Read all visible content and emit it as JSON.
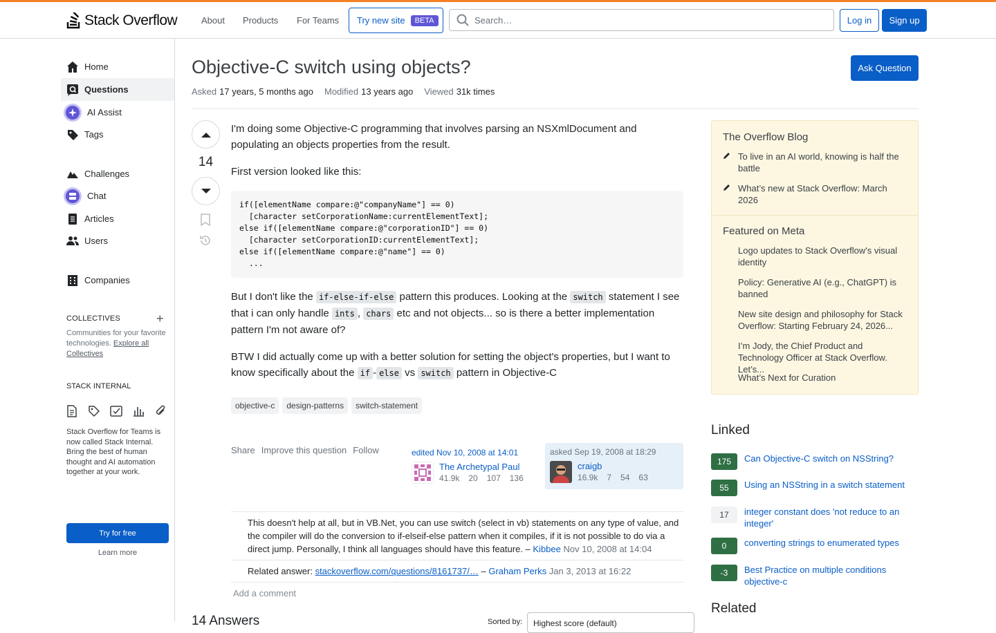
{
  "header": {
    "logo_text": "Stack Overflow",
    "nav": [
      "About",
      "Products",
      "For Teams"
    ],
    "try_new_site": "Try new site",
    "beta_badge": "BETA",
    "search_placeholder": "Search…",
    "login": "Log in",
    "signup": "Sign up"
  },
  "sidebar": {
    "items": [
      {
        "label": "Home",
        "icon": "home-icon"
      },
      {
        "label": "Questions",
        "icon": "questions-icon"
      },
      {
        "label": "AI Assist",
        "icon": "ai-assist-icon"
      },
      {
        "label": "Tags",
        "icon": "tag-icon"
      },
      {
        "label": "Challenges",
        "icon": "challenges-icon"
      },
      {
        "label": "Chat",
        "icon": "chat-icon"
      },
      {
        "label": "Articles",
        "icon": "articles-icon"
      },
      {
        "label": "Users",
        "icon": "users-icon"
      },
      {
        "label": "Companies",
        "icon": "companies-icon"
      }
    ],
    "collectives_heading": "COLLECTIVES",
    "collectives_desc": "Communities for your favorite technologies.",
    "collectives_link": "Explore all Collectives",
    "stack_internal_heading": "STACK INTERNAL",
    "stack_internal_desc": "Stack Overflow for Teams is now called Stack Internal. Bring the best of human thought and AI automation together at your work.",
    "try_free": "Try for free",
    "learn_more": "Learn more"
  },
  "question": {
    "title": "Objective-C switch using objects?",
    "ask_button": "Ask Question",
    "asked_label": "Asked",
    "asked_value": "17 years, 5 months ago",
    "modified_label": "Modified",
    "modified_value": "13 years ago",
    "viewed_label": "Viewed",
    "viewed_value": "31k times",
    "votes": "14",
    "body_p1": "I'm doing some Objective-C programming that involves parsing an NSXmlDocument and populating an objects properties from the result.",
    "body_p2": "First version looked like this:",
    "code": "if([elementName compare:@\"companyName\"] == 0)\n  [character setCorporationName:currentElementText];\nelse if([elementName compare:@\"corporationID\"] == 0)\n  [character setCorporationID:currentElementText];\nelse if([elementName compare:@\"name\"] == 0)\n  ...",
    "p3_a": "But I don't like the ",
    "p3_code1": "if-else-if-else",
    "p3_b": " pattern this produces. Looking at the ",
    "p3_code2": "switch",
    "p3_c": " statement I see that i can only handle ",
    "p3_code3": "ints",
    "p3_d": ", ",
    "p3_code4": "chars",
    "p3_e": " etc and not objects... so is there a better implementation pattern I'm not aware of?",
    "p4_a": "BTW I did actually come up with a better solution for setting the object's properties, but I want to know specifically about the ",
    "p4_code1": "if",
    "p4_dash": "-",
    "p4_code2": "else",
    "p4_b": " vs ",
    "p4_code3": "switch",
    "p4_c": " pattern in Objective-C",
    "tags": [
      "objective-c",
      "design-patterns",
      "switch-statement"
    ],
    "actions": [
      "Share",
      "Improve this question",
      "Follow"
    ],
    "edited": {
      "label": "edited Nov 10, 2008 at 14:01",
      "user": "The Archetypal Paul",
      "rep": "41.9k",
      "gold": "20",
      "silver": "107",
      "bronze": "136"
    },
    "asked": {
      "label": "asked Sep 19, 2008 at 18:29",
      "user": "craigb",
      "rep": "16.9k",
      "gold": "7",
      "silver": "54",
      "bronze": "63"
    },
    "comments": [
      {
        "text": "This doesn't help at all, but in VB.Net, you can use switch (select in vb) statements on any type of value, and the compiler will do the conversion to if-elseif-else pattern when it compiles, if it is not possible to do via a direct jump. Personally, I think all languages should have this feature. – ",
        "user": "Kibbee",
        "date": "Nov 10, 2008 at 14:04"
      },
      {
        "text": "Related answer: ",
        "link": "stackoverflow.com/questions/8161737/…",
        "sep": " – ",
        "user": "Graham Perks",
        "date": "Jan 3, 2013 at 16:22"
      }
    ],
    "add_comment": "Add a comment"
  },
  "answers": {
    "heading": "14 Answers",
    "sort_label": "Sorted by:",
    "sort_value": "Highest score (default)"
  },
  "right": {
    "blog_heading": "The Overflow Blog",
    "blog_items": [
      "To live in an AI world, knowing is half the battle",
      "What’s new at Stack Overflow: March 2026"
    ],
    "meta_heading": "Featured on Meta",
    "meta_items": [
      "Logo updates to Stack Overflow's visual identity",
      "Policy: Generative AI (e.g., ChatGPT) is banned",
      "New site design and philosophy for Stack Overflow: Starting February 24, 2026...",
      "I’m Jody, the Chief Product and Technology Officer at Stack Overflow. Let’s...",
      "What’s Next for Curation"
    ],
    "linked_heading": "Linked",
    "linked": [
      {
        "score": "175",
        "title": "Can Objective-C switch on NSString?",
        "accepted": true
      },
      {
        "score": "55",
        "title": "Using an NSString in a switch statement",
        "accepted": true
      },
      {
        "score": "17",
        "title": "integer constant does 'not reduce to an integer'",
        "accepted": false
      },
      {
        "score": "0",
        "title": "converting strings to enumerated types",
        "accepted": true
      },
      {
        "score": "-3",
        "title": "Best Practice on multiple conditions objective-c",
        "accepted": true
      }
    ],
    "related_heading": "Related"
  },
  "colors": {
    "accent": "#f48225",
    "link": "#0a5ec7",
    "accepted": "#2f6f44",
    "yellow_box": "#fdf7e2"
  }
}
